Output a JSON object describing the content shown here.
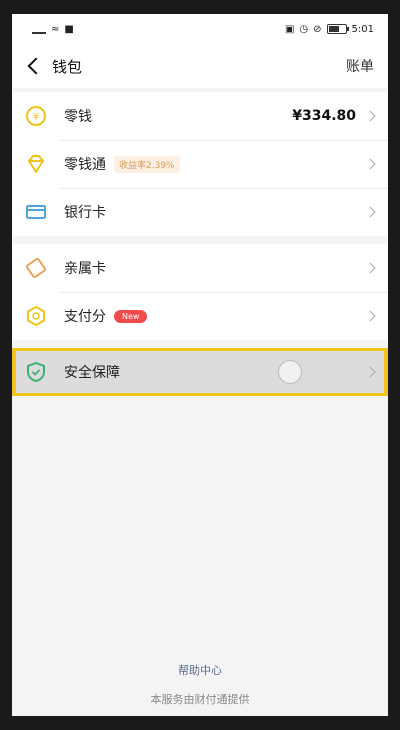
{
  "status_bar": {
    "time": "5:01"
  },
  "header": {
    "title": "钱包",
    "bill": "账单"
  },
  "groups": [
    [
      {
        "label": "零钱",
        "value": "¥334.80"
      },
      {
        "label": "零钱通",
        "badge": "收益率2.39%"
      },
      {
        "label": "银行卡"
      }
    ],
    [
      {
        "label": "亲属卡"
      },
      {
        "label": "支付分",
        "badge": "New"
      }
    ],
    [
      {
        "label": "安全保障"
      }
    ]
  ],
  "footer": {
    "help": "帮助中心",
    "provider": "本服务由财付通提供"
  },
  "colors": {
    "yellow": "#f2c31a",
    "orange_bg": "#fdf0e3",
    "red": "#f24b4b",
    "green": "#3cb371",
    "blue": "#4aa3df"
  }
}
